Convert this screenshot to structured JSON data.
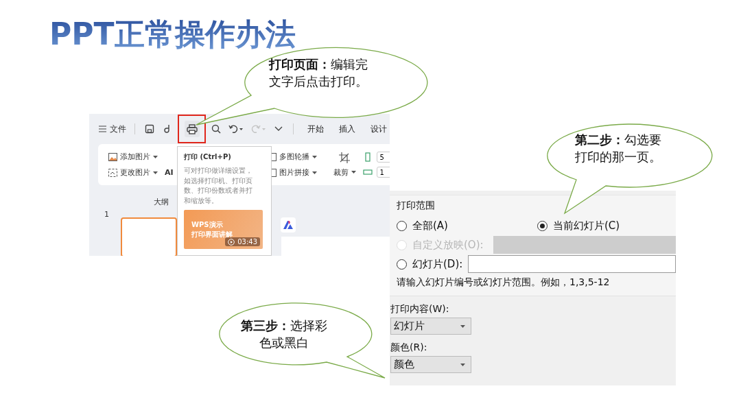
{
  "title": "PPT正常操作办法",
  "callouts": [
    {
      "text": "**打印页面：**编辑完文字后点击打印。"
    },
    {
      "text": "**第二步：**勾选要打印的那一页。"
    },
    {
      "text": "**第三步：**选择彩色或黑白"
    }
  ],
  "wps": {
    "file_menu": "文件",
    "quick_tools": [
      {
        "kind": "save",
        "highlighted": false,
        "disabled": false
      },
      {
        "kind": "export",
        "highlighted": false,
        "disabled": false
      },
      {
        "kind": "print",
        "highlighted": true,
        "disabled": false
      },
      {
        "kind": "preview",
        "highlighted": false,
        "disabled": false
      },
      {
        "kind": "undo",
        "highlighted": false,
        "disabled": false
      },
      {
        "kind": "redo",
        "highlighted": false,
        "disabled": true
      },
      {
        "kind": "more",
        "highlighted": false,
        "disabled": false
      }
    ],
    "tabs": [
      {
        "label": "开始"
      },
      {
        "label": "插入"
      },
      {
        "label": "设计"
      }
    ],
    "ribbon": {
      "picture_tools": [
        {
          "label": "添加图片"
        },
        {
          "label": "更改图片"
        }
      ],
      "ai_label": "AI",
      "layout_tools": [
        {
          "label": "多图轮播"
        },
        {
          "label": "图片拼接"
        }
      ],
      "crop": "裁剪",
      "size_fields": [
        {
          "value": "5"
        },
        {
          "value": "1"
        }
      ]
    },
    "outline_tab": "大纲",
    "slide_number": "1",
    "tooltip": {
      "title": "打印 (Ctrl+P)",
      "description": "可对打印做详细设置，如选择打印机、打印页数、打印份数或者并打和缩放等。",
      "video_title_lines": [
        "WPS演示",
        "打印界面讲解"
      ],
      "duration": "03:43"
    }
  },
  "print_dialog": {
    "range_label": "打印范围",
    "options": [
      {
        "kind": "radio",
        "label": "全部(A)",
        "selected": false,
        "disabled": false
      },
      {
        "kind": "radio",
        "label": "当前幻灯片(C)",
        "selected": true,
        "disabled": false
      },
      {
        "kind": "combo",
        "label": "自定义放映(O):",
        "selected": false,
        "disabled": true
      },
      {
        "kind": "text",
        "label": "幻灯片(D):",
        "selected": false,
        "disabled": false
      }
    ],
    "hint": "请输入幻灯片编号或幻灯片范围。例如，1,3,5-12",
    "fields": [
      {
        "label": "打印内容(W):",
        "value": "幻灯片"
      },
      {
        "label": "颜色(R):",
        "value": "颜色"
      }
    ]
  }
}
